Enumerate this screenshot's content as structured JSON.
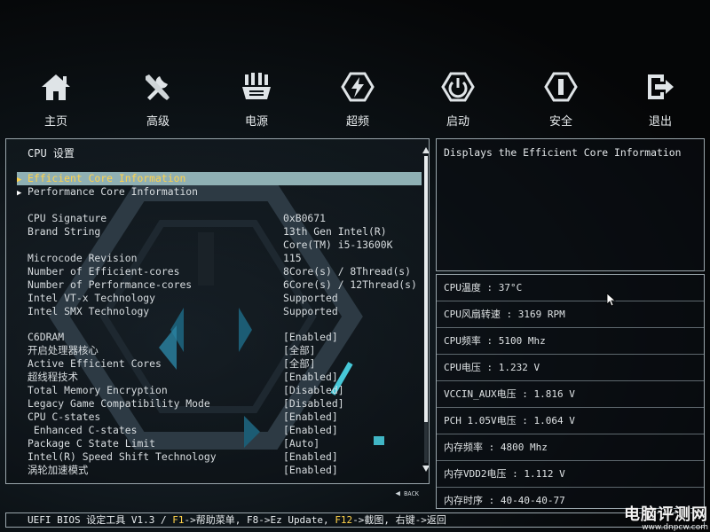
{
  "nav": [
    {
      "label": "主页",
      "icon": "home-icon"
    },
    {
      "label": "高级",
      "icon": "tools-icon"
    },
    {
      "label": "电源",
      "icon": "power-supply-icon"
    },
    {
      "label": "超频",
      "icon": "overclock-icon"
    },
    {
      "label": "启动",
      "icon": "power-button-icon"
    },
    {
      "label": "安全",
      "icon": "security-icon"
    },
    {
      "label": "退出",
      "icon": "exit-icon"
    }
  ],
  "left": {
    "title": "CPU 设置",
    "submenus": [
      {
        "label": "Efficient Core Information",
        "selected": true
      },
      {
        "label": "Performance Core Information",
        "selected": false
      }
    ],
    "info_rows": [
      {
        "label": "CPU Signature",
        "value": "0xB0671"
      },
      {
        "label": "Brand String",
        "value": "13th Gen Intel(R)"
      },
      {
        "label": "",
        "value": "Core(TM) i5-13600K"
      },
      {
        "label": "Microcode Revision",
        "value": "115"
      },
      {
        "label": "Number of Efficient-cores",
        "value": "8Core(s) / 8Thread(s)"
      },
      {
        "label": "Number of Performance-cores",
        "value": "6Core(s) / 12Thread(s)"
      },
      {
        "label": "Intel VT-x Technology",
        "value": "Supported"
      },
      {
        "label": "Intel SMX Technology",
        "value": "Supported"
      }
    ],
    "settings": [
      {
        "label": "C6DRAM",
        "value": "[Enabled]"
      },
      {
        "label": "开启处理器核心",
        "value": "[全部]"
      },
      {
        "label": "Active Efficient Cores",
        "value": "[全部]"
      },
      {
        "label": "超线程技术",
        "value": "[Enabled]"
      },
      {
        "label": "Total Memory Encryption",
        "value": "[Disabled]"
      },
      {
        "label": "Legacy Game Compatibility Mode",
        "value": "[Disabled]"
      },
      {
        "label": "CPU C-states",
        "value": "[Enabled]"
      },
      {
        "label": " Enhanced C-states",
        "value": "[Enabled]"
      },
      {
        "label": "Package C State Limit",
        "value": "[Auto]"
      },
      {
        "label": "Intel(R) Speed Shift Technology",
        "value": "[Enabled]"
      },
      {
        "label": "涡轮加速模式",
        "value": "[Enabled]"
      }
    ],
    "back_label": "BACK"
  },
  "help": {
    "text": "Displays the Efficient Core Information"
  },
  "monitor": [
    "CPU温度 : 37°C",
    "CPU风扇转速 : 3169 RPM",
    "CPU频率 : 5100 Mhz",
    "CPU电压 : 1.232 V",
    "VCCIN_AUX电压 : 1.816 V",
    "PCH 1.05V电压 : 1.064 V",
    "内存频率 : 4800 Mhz",
    "内存VDD2电压 : 1.112 V",
    "内存时序 : 40-40-40-77"
  ],
  "status": {
    "prefix": "UEFI BIOS 设定工具 V1.3 / ",
    "f1": "F1",
    "f1_text": "->帮助菜单, F8->Ez Update, ",
    "f12": "F12",
    "f12_text": "->截图, 右键->返回"
  },
  "watermark": {
    "main": "电脑评测网",
    "sub": "www.dnpcw.com"
  },
  "colors": {
    "accent": "#ffd24a",
    "highlight": "#8fb0b4",
    "cyan": "#46c8d8"
  }
}
